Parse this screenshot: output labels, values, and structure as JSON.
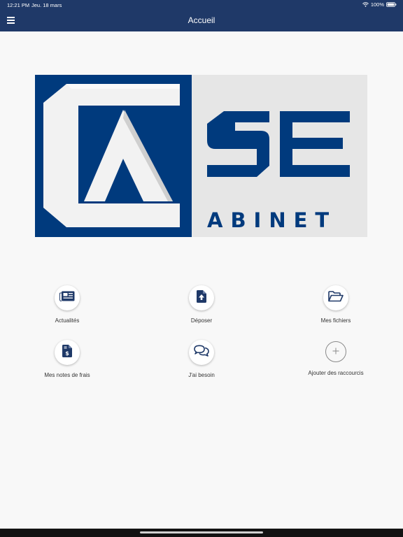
{
  "status_bar": {
    "time": "12:21 PM",
    "date": "Jeu. 18 mars",
    "battery": "100%"
  },
  "header": {
    "title": "Accueil"
  },
  "logo": {
    "text_top": "SE",
    "text_bottom": "ABINET"
  },
  "shortcuts": [
    {
      "label": "Actualités",
      "icon": "newspaper-icon"
    },
    {
      "label": "Déposer",
      "icon": "file-upload-icon"
    },
    {
      "label": "Mes fichiers",
      "icon": "folder-open-icon"
    },
    {
      "label": "Mes notes de frais",
      "icon": "invoice-dollar-icon"
    },
    {
      "label": "J'ai besoin",
      "icon": "chat-bubbles-icon"
    },
    {
      "label": "Ajouter des raccourcis",
      "icon": "plus-icon"
    }
  ],
  "colors": {
    "brand": "#1f3968",
    "logo_blue": "#003a7d",
    "logo_gray": "#e6e6e6"
  }
}
